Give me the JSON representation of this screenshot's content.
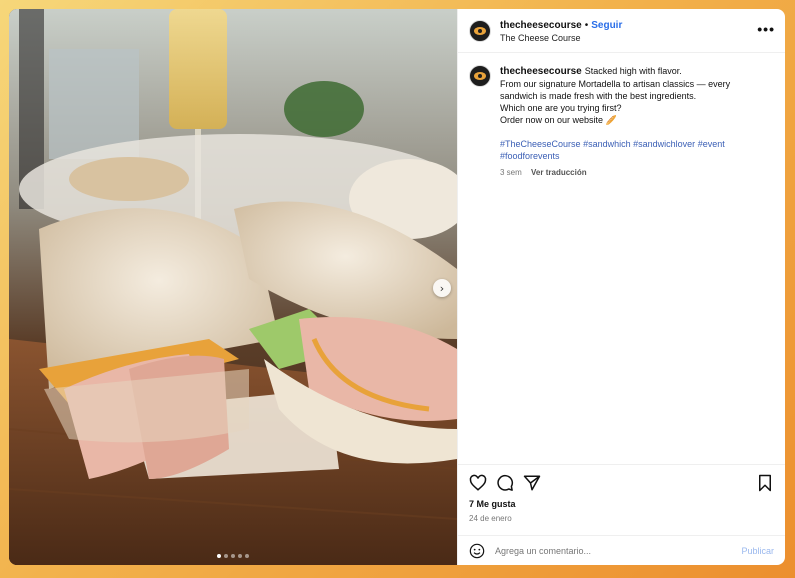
{
  "post": {
    "username": "thecheesecourse",
    "separator": "•",
    "follow_label": "Seguir",
    "display_name": "The Cheese Course",
    "more_label": "•••",
    "next_label": "›",
    "carousel": {
      "total": 5,
      "active_index": 0
    }
  },
  "caption": {
    "username": "thecheesecourse",
    "lines": [
      "Stacked high with flavor.",
      "From our signature Mortadella to artisan classics — every",
      "sandwich is made fresh with the best ingredients.",
      "Which one are you trying first?",
      "Order now on our website 🥖"
    ],
    "hashtags_line1": [
      "#TheCheeseCourse",
      "#sandwhich",
      "#sandwichlover",
      "#event"
    ],
    "hashtags_line2": [
      "#foodforevents"
    ],
    "time_ago": "3 sem",
    "translate_label": "Ver traducción"
  },
  "actions": {
    "likes": "7 Me gusta",
    "date": "24 de enero",
    "icons": [
      "heart-icon",
      "comment-icon",
      "share-icon",
      "bookmark-icon"
    ]
  },
  "comment": {
    "placeholder": "Agrega un comentario...",
    "publish_label": "Publicar"
  },
  "colors": {
    "link_blue": "#2a6ee8",
    "hashtag_blue": "#3b5fb5",
    "publish_disabled": "#9ab8ee",
    "background_gradient_start": "#f6d77a",
    "background_gradient_end": "#ec8f2e"
  }
}
